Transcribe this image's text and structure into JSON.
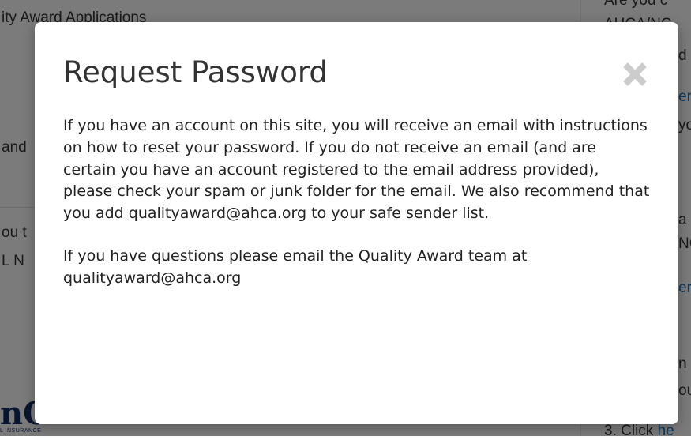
{
  "modal": {
    "title": "Request Password",
    "close_icon": "close-icon",
    "paragraph_1": "If you have an account on this site, you will receive an email with instructions on how to reset your password. If you do not receive an email (and are certain you have an account registered to the email address provided), please check your spam or junk folder for the email. We also recommend that you add qualityaward@ahca.org to your safe sender list.",
    "paragraph_2": "If you have questions please email the Quality Award team at qualityaward@ahca.org"
  },
  "background": {
    "heading_fragment": "ity Award Applications",
    "left_fragment_1": "and",
    "left_fragment_2": "ou t",
    "left_fragment_3": "L N",
    "logo_fragment": "nC",
    "logo_sub_fragment": "L INSURANCE",
    "right_fragment_1": "Are you c",
    "right_fragment_2": "AHCA/NC",
    "right_fragment_3": "d",
    "right_fragment_4": "er",
    "right_fragment_5": "yo",
    "right_fragment_6": "a",
    "right_fragment_7": "NC",
    "right_fragment_8": "er",
    "right_fragment_9": "n",
    "right_fragment_10": "ou",
    "right_fragment_11": "3. Click ",
    "right_fragment_12": "he"
  },
  "colors": {
    "overlay": "#000000",
    "modal_background": "#ffffff",
    "title_text": "#333333",
    "body_text": "#222222",
    "close_icon": "#cccccc",
    "link": "#1a73b8"
  }
}
